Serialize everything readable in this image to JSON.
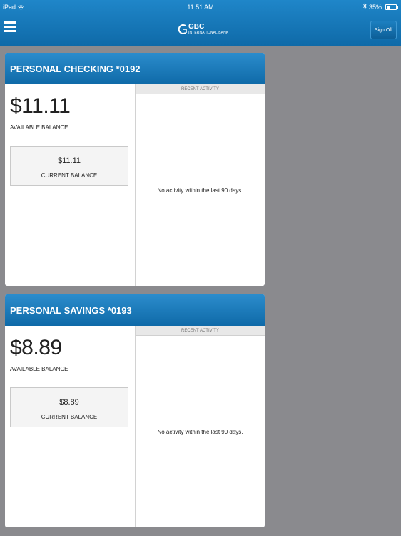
{
  "status_bar": {
    "device": "iPad",
    "wifi_icon": "wifi-icon",
    "time": "11:51 AM",
    "bluetooth_icon": "bluetooth-icon",
    "battery": "35%"
  },
  "header": {
    "menu_icon": "hamburger-menu-icon",
    "logo_text": "GBC",
    "logo_sub": "INTERNATIONAL BANK",
    "signoff_label": "Sign Off",
    "bar_color": "#1575b8"
  },
  "accounts": [
    {
      "title": "PERSONAL CHECKING *0192",
      "available_balance": "$11.11",
      "available_label": "AVAILABLE BALANCE",
      "current_balance": "$11.11",
      "current_label": "CURRENT BALANCE",
      "recent_header": "RECENT ACTIVITY",
      "no_activity": "No activity within the last 90 days."
    },
    {
      "title": "PERSONAL SAVINGS *0193",
      "available_balance": "$8.89",
      "available_label": "AVAILABLE BALANCE",
      "current_balance": "$8.89",
      "current_label": "CURRENT BALANCE",
      "recent_header": "RECENT ACTIVITY",
      "no_activity": "No activity within the last 90 days."
    }
  ]
}
